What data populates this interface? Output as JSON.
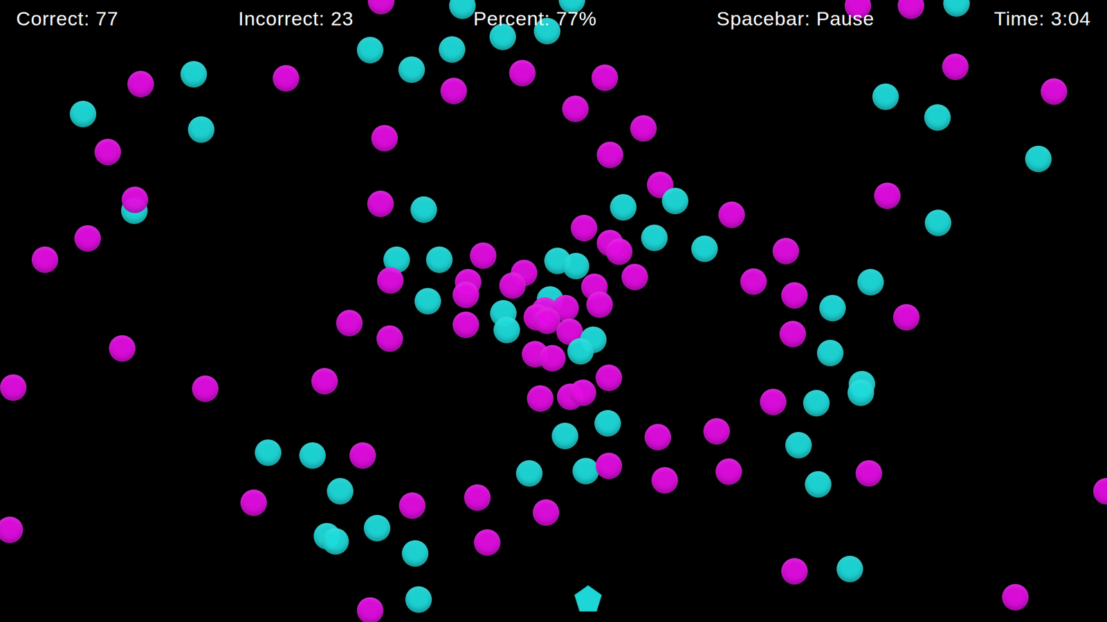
{
  "hud": [
    {
      "text": "Correct: 77"
    },
    {
      "text": "Incorrect: 23"
    },
    {
      "text": "Percent: 77%"
    },
    {
      "text": "Spacebar: Pause"
    },
    {
      "text": "Time: 3:04"
    }
  ],
  "player": {
    "color": "#1fd6d6"
  },
  "balls": [
    {
      "color": "#e30de3"
    },
    {
      "color": "#1fdcdc"
    },
    {
      "color": "#1fdcdc"
    },
    {
      "color": "#e30de3"
    },
    {
      "color": "#e30de3"
    },
    {
      "color": "#1fdcdc"
    },
    {
      "color": "#1fdcdc"
    },
    {
      "color": "#1fdcdc"
    },
    {
      "color": "#1fdcdc"
    },
    {
      "color": "#1fdcdc"
    },
    {
      "color": "#1fdcdc"
    },
    {
      "color": "#e30de3"
    },
    {
      "color": "#e30de3"
    },
    {
      "color": "#e30de3"
    },
    {
      "color": "#e30de3"
    },
    {
      "color": "#1fdcdc"
    },
    {
      "color": "#e30de3"
    },
    {
      "color": "#e30de3"
    },
    {
      "color": "#1fdcdc"
    },
    {
      "color": "#1fdcdc"
    },
    {
      "color": "#e30de3"
    },
    {
      "color": "#e30de3"
    },
    {
      "color": "#e30de3"
    },
    {
      "color": "#e30de3"
    },
    {
      "color": "#1fdcdc"
    },
    {
      "color": "#1fdcdc"
    },
    {
      "color": "#e30de3"
    },
    {
      "color": "#e30de3"
    },
    {
      "color": "#1fdcdc"
    },
    {
      "color": "#1fdcdc"
    },
    {
      "color": "#e30de3"
    },
    {
      "color": "#e30de3"
    },
    {
      "color": "#e30de3"
    },
    {
      "color": "#e30de3"
    },
    {
      "color": "#1fdcdc"
    },
    {
      "color": "#e30de3"
    },
    {
      "color": "#1fdcdc"
    },
    {
      "color": "#1fdcdc"
    },
    {
      "color": "#e30de3"
    },
    {
      "color": "#e30de3"
    },
    {
      "color": "#e30de3"
    },
    {
      "color": "#e30de3"
    },
    {
      "color": "#1fdcdc"
    },
    {
      "color": "#1fdcdc"
    },
    {
      "color": "#e30de3"
    },
    {
      "color": "#e30de3"
    },
    {
      "color": "#1fdcdc"
    },
    {
      "color": "#1fdcdc"
    },
    {
      "color": "#1fdcdc"
    },
    {
      "color": "#e30de3"
    },
    {
      "color": "#1fdcdc"
    },
    {
      "color": "#1fdcdc"
    },
    {
      "color": "#e30de3"
    },
    {
      "color": "#e30de3"
    },
    {
      "color": "#e30de3"
    },
    {
      "color": "#e30de3"
    },
    {
      "color": "#e30de3"
    },
    {
      "color": "#1fdcdc"
    },
    {
      "color": "#1fdcdc"
    },
    {
      "color": "#e30de3"
    },
    {
      "color": "#e30de3"
    },
    {
      "color": "#e30de3"
    },
    {
      "color": "#e30de3"
    },
    {
      "color": "#e30de3"
    },
    {
      "color": "#1fdcdc"
    },
    {
      "color": "#1fdcdc"
    },
    {
      "color": "#e30de3"
    },
    {
      "color": "#1fdcdc"
    },
    {
      "color": "#e30de3"
    },
    {
      "color": "#e30de3"
    },
    {
      "color": "#e30de3"
    },
    {
      "color": "#e30de3"
    },
    {
      "color": "#e30de3"
    },
    {
      "color": "#1fdcdc"
    },
    {
      "color": "#e30de3"
    },
    {
      "color": "#e30de3"
    },
    {
      "color": "#e30de3"
    },
    {
      "color": "#1fdcdc"
    },
    {
      "color": "#1fdcdc"
    },
    {
      "color": "#e30de3"
    },
    {
      "color": "#e30de3"
    },
    {
      "color": "#e30de3"
    },
    {
      "color": "#1fdcdc"
    },
    {
      "color": "#e30de3"
    },
    {
      "color": "#e30de3"
    },
    {
      "color": "#e30de3"
    },
    {
      "color": "#e30de3"
    },
    {
      "color": "#e30de3"
    },
    {
      "color": "#e30de3"
    },
    {
      "color": "#e30de3"
    },
    {
      "color": "#e30de3"
    },
    {
      "color": "#1fdcdc"
    },
    {
      "color": "#1fdcdc"
    },
    {
      "color": "#e30de3"
    },
    {
      "color": "#1fdcdc"
    },
    {
      "color": "#1fdcdc"
    },
    {
      "color": "#1fdcdc"
    },
    {
      "color": "#e30de3"
    },
    {
      "color": "#e30de3"
    },
    {
      "color": "#1fdcdc"
    },
    {
      "color": "#e30de3"
    },
    {
      "color": "#1fdcdc"
    },
    {
      "color": "#1fdcdc"
    },
    {
      "color": "#1fdcdc"
    },
    {
      "color": "#e30de3"
    },
    {
      "color": "#1fdcdc"
    },
    {
      "color": "#1fdcdc"
    },
    {
      "color": "#e30de3"
    },
    {
      "color": "#e30de3"
    },
    {
      "color": "#e30de3"
    },
    {
      "color": "#1fdcdc"
    },
    {
      "color": "#e30de3"
    },
    {
      "color": "#e30de3"
    },
    {
      "color": "#e30de3"
    },
    {
      "color": "#e30de3"
    },
    {
      "color": "#1fdcdc"
    },
    {
      "color": "#1fdcdc"
    },
    {
      "color": "#1fdcdc"
    },
    {
      "color": "#1fdcdc"
    },
    {
      "color": "#e30de3"
    },
    {
      "color": "#e30de3"
    },
    {
      "color": "#e30de3"
    },
    {
      "color": "#e30de3"
    },
    {
      "color": "#1fdcdc"
    },
    {
      "color": "#e30de3"
    },
    {
      "color": "#1fdcdc"
    },
    {
      "color": "#e30de3"
    }
  ]
}
